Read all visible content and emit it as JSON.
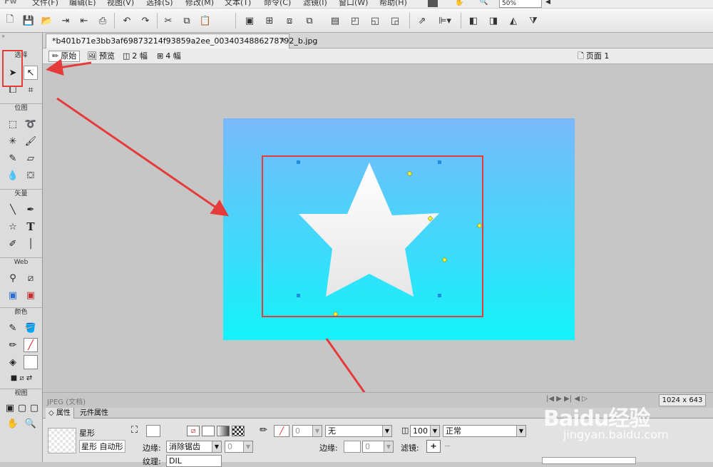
{
  "menu": [
    "文件(F)",
    "编辑(E)",
    "视图(V)",
    "选择(S)",
    "修改(M)",
    "文本(T)",
    "命令(C)",
    "滤镜(I)",
    "窗口(W)",
    "帮助(H)"
  ],
  "zoom": "50%",
  "tools": {
    "groups": {
      "select": "选择",
      "bitmap": "位图",
      "vector": "矢量",
      "web": "Web",
      "colors": "颜色",
      "view": "视图"
    },
    "vector_text_tool": "T"
  },
  "document": {
    "tab_title": "*b401b71e3bb3af69873214f93859a2ee_0034034886278792_b.jpg",
    "views": {
      "original": "原始",
      "preview": "预览",
      "two_up": "2 幅",
      "four_up": "4 幅"
    },
    "page": "页面 1"
  },
  "status": {
    "file_type": "JPEG (文档)",
    "size": "1024 x 643"
  },
  "properties": {
    "tabs": {
      "properties": "属性",
      "symbol": "元件属性"
    },
    "object_type": "星形",
    "object_subtype": "星形 自动形",
    "edge_label": "边缘:",
    "edge_value": "消除锯齿",
    "edge_amount": "0",
    "stroke_value": "0",
    "stroke_type": "无",
    "stroke_edge_label": "边缘:",
    "stroke_edge_amount": "0",
    "texture_label": "纹理:",
    "texture_value": "DIL",
    "opacity": "100",
    "blend_mode": "正常",
    "filters_label": "滤镜:",
    "filter_add": "+",
    "filter_remove": "−"
  },
  "watermark": {
    "brand": "Baidu经验",
    "url": "jingyan.baidu.com"
  },
  "colors": {
    "accent_red": "#e53b3b",
    "sky_top": "#79b8fb",
    "sky_bottom": "#13f3fb"
  }
}
